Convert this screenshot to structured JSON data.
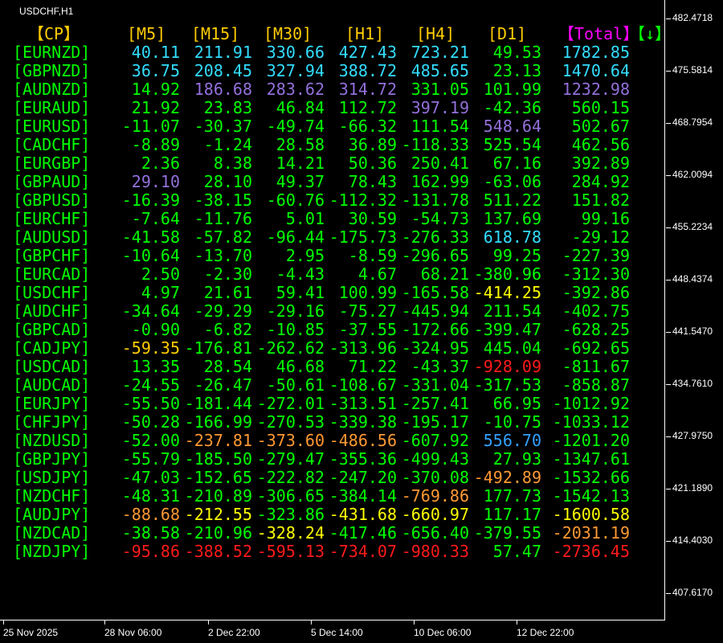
{
  "window": {
    "symbol_title": "USDCHF,H1"
  },
  "colors": {
    "green": "#00ff00",
    "cyan": "#33ddff",
    "purple": "#9370db",
    "yellow": "#ffff00",
    "gold": "#ffcc00",
    "orange": "#ff9933",
    "red": "#ff1a1a",
    "blue": "#33a0ff",
    "magenta": "#ff00ff",
    "white": "#ffffff"
  },
  "table": {
    "headers": [
      {
        "text": "【CP】",
        "color": "gold"
      },
      {
        "text": "[M5]",
        "color": "gold"
      },
      {
        "text": "[M15]",
        "color": "gold"
      },
      {
        "text": "[M30]",
        "color": "gold"
      },
      {
        "text": "[H1]",
        "color": "gold"
      },
      {
        "text": "[H4]",
        "color": "gold"
      },
      {
        "text": "[D1]",
        "color": "gold"
      },
      {
        "text": "【Total】",
        "color": "magenta"
      },
      {
        "text": "【↓】",
        "color": "green"
      }
    ],
    "rows": [
      {
        "pair": "[EURNZD]",
        "vals": [
          "40.11",
          "211.91",
          "330.66",
          "427.43",
          "723.21",
          "49.53",
          "1782.85"
        ],
        "colors": [
          "cyan",
          "cyan",
          "cyan",
          "cyan",
          "cyan",
          "green",
          "cyan"
        ]
      },
      {
        "pair": "[GBPNZD]",
        "vals": [
          "36.75",
          "208.45",
          "327.94",
          "388.72",
          "485.65",
          "23.13",
          "1470.64"
        ],
        "colors": [
          "cyan",
          "cyan",
          "cyan",
          "cyan",
          "cyan",
          "green",
          "cyan"
        ]
      },
      {
        "pair": "[AUDNZD]",
        "vals": [
          "14.92",
          "186.68",
          "283.62",
          "314.72",
          "331.05",
          "101.99",
          "1232.98"
        ],
        "colors": [
          "green",
          "purple",
          "purple",
          "purple",
          "green",
          "green",
          "purple"
        ]
      },
      {
        "pair": "[EURAUD]",
        "vals": [
          "21.92",
          "23.83",
          "46.84",
          "112.72",
          "397.19",
          "-42.36",
          "560.15"
        ],
        "colors": [
          "green",
          "green",
          "green",
          "green",
          "purple",
          "green",
          "green"
        ]
      },
      {
        "pair": "[EURUSD]",
        "vals": [
          "-11.07",
          "-30.37",
          "-49.74",
          "-66.32",
          "111.54",
          "548.64",
          "502.67"
        ],
        "colors": [
          "green",
          "green",
          "green",
          "green",
          "green",
          "purple",
          "green"
        ]
      },
      {
        "pair": "[CADCHF]",
        "vals": [
          "-8.89",
          "-1.24",
          "28.58",
          "36.89",
          "-118.33",
          "525.54",
          "462.56"
        ],
        "colors": [
          "green",
          "green",
          "green",
          "green",
          "green",
          "green",
          "green"
        ]
      },
      {
        "pair": "[EURGBP]",
        "vals": [
          "2.36",
          "8.38",
          "14.21",
          "50.36",
          "250.41",
          "67.16",
          "392.89"
        ],
        "colors": [
          "green",
          "green",
          "green",
          "green",
          "green",
          "green",
          "green"
        ]
      },
      {
        "pair": "[GBPAUD]",
        "vals": [
          "29.10",
          "28.10",
          "49.37",
          "78.43",
          "162.99",
          "-63.06",
          "284.92"
        ],
        "colors": [
          "purple",
          "green",
          "green",
          "green",
          "green",
          "green",
          "green"
        ]
      },
      {
        "pair": "[GBPUSD]",
        "vals": [
          "-16.39",
          "-38.15",
          "-60.76",
          "-112.32",
          "-131.78",
          "511.22",
          "151.82"
        ],
        "colors": [
          "green",
          "green",
          "green",
          "green",
          "green",
          "green",
          "green"
        ]
      },
      {
        "pair": "[EURCHF]",
        "vals": [
          "-7.64",
          "-11.76",
          "5.01",
          "30.59",
          "-54.73",
          "137.69",
          "99.16"
        ],
        "colors": [
          "green",
          "green",
          "green",
          "green",
          "green",
          "green",
          "green"
        ]
      },
      {
        "pair": "[AUDUSD]",
        "vals": [
          "-41.58",
          "-57.82",
          "-96.44",
          "-175.73",
          "-276.33",
          "618.78",
          "-29.12"
        ],
        "colors": [
          "green",
          "green",
          "green",
          "green",
          "green",
          "cyan",
          "green"
        ]
      },
      {
        "pair": "[GBPCHF]",
        "vals": [
          "-10.64",
          "-13.70",
          "2.95",
          "-8.59",
          "-296.65",
          "99.25",
          "-227.39"
        ],
        "colors": [
          "green",
          "green",
          "green",
          "green",
          "green",
          "green",
          "green"
        ]
      },
      {
        "pair": "[EURCAD]",
        "vals": [
          "2.50",
          "-2.30",
          "-4.43",
          "4.67",
          "68.21",
          "-380.96",
          "-312.30"
        ],
        "colors": [
          "green",
          "green",
          "green",
          "green",
          "green",
          "green",
          "green"
        ]
      },
      {
        "pair": "[USDCHF]",
        "vals": [
          "4.97",
          "21.61",
          "59.41",
          "100.99",
          "-165.58",
          "-414.25",
          "-392.86"
        ],
        "colors": [
          "green",
          "green",
          "green",
          "green",
          "green",
          "yellow",
          "green"
        ]
      },
      {
        "pair": "[AUDCHF]",
        "vals": [
          "-34.64",
          "-29.29",
          "-29.16",
          "-75.27",
          "-445.94",
          "211.54",
          "-402.75"
        ],
        "colors": [
          "green",
          "green",
          "green",
          "green",
          "green",
          "green",
          "green"
        ]
      },
      {
        "pair": "[GBPCAD]",
        "vals": [
          "-0.90",
          "-6.82",
          "-10.85",
          "-37.55",
          "-172.66",
          "-399.47",
          "-628.25"
        ],
        "colors": [
          "green",
          "green",
          "green",
          "green",
          "green",
          "green",
          "green"
        ]
      },
      {
        "pair": "[CADJPY]",
        "vals": [
          "-59.35",
          "-176.81",
          "-262.62",
          "-313.96",
          "-324.95",
          "445.04",
          "-692.65"
        ],
        "colors": [
          "gold",
          "green",
          "green",
          "green",
          "green",
          "green",
          "green"
        ]
      },
      {
        "pair": "[USDCAD]",
        "vals": [
          "13.35",
          "28.54",
          "46.68",
          "71.22",
          "-43.37",
          "-928.09",
          "-811.67"
        ],
        "colors": [
          "green",
          "green",
          "green",
          "green",
          "green",
          "red",
          "green"
        ]
      },
      {
        "pair": "[AUDCAD]",
        "vals": [
          "-24.55",
          "-26.47",
          "-50.61",
          "-108.67",
          "-331.04",
          "-317.53",
          "-858.87"
        ],
        "colors": [
          "green",
          "green",
          "green",
          "green",
          "green",
          "green",
          "green"
        ]
      },
      {
        "pair": "[EURJPY]",
        "vals": [
          "-55.50",
          "-181.44",
          "-272.01",
          "-313.51",
          "-257.41",
          "66.95",
          "-1012.92"
        ],
        "colors": [
          "green",
          "green",
          "green",
          "green",
          "green",
          "green",
          "green"
        ]
      },
      {
        "pair": "[CHFJPY]",
        "vals": [
          "-50.28",
          "-166.99",
          "-270.53",
          "-339.38",
          "-195.17",
          "-10.75",
          "-1033.12"
        ],
        "colors": [
          "green",
          "green",
          "green",
          "green",
          "green",
          "green",
          "green"
        ]
      },
      {
        "pair": "[NZDUSD]",
        "vals": [
          "-52.00",
          "-237.81",
          "-373.60",
          "-486.56",
          "-607.92",
          "556.70",
          "-1201.20"
        ],
        "colors": [
          "green",
          "orange",
          "orange",
          "orange",
          "green",
          "blue",
          "green"
        ]
      },
      {
        "pair": "[GBPJPY]",
        "vals": [
          "-55.79",
          "-185.50",
          "-279.47",
          "-355.36",
          "-499.43",
          "27.93",
          "-1347.61"
        ],
        "colors": [
          "green",
          "green",
          "green",
          "green",
          "green",
          "green",
          "green"
        ]
      },
      {
        "pair": "[USDJPY]",
        "vals": [
          "-47.03",
          "-152.65",
          "-222.82",
          "-247.20",
          "-370.08",
          "-492.89",
          "-1532.66"
        ],
        "colors": [
          "green",
          "green",
          "green",
          "green",
          "green",
          "orange",
          "green"
        ]
      },
      {
        "pair": "[NZDCHF]",
        "vals": [
          "-48.31",
          "-210.89",
          "-306.65",
          "-384.14",
          "-769.86",
          "177.73",
          "-1542.13"
        ],
        "colors": [
          "green",
          "green",
          "green",
          "green",
          "orange",
          "green",
          "green"
        ]
      },
      {
        "pair": "[AUDJPY]",
        "vals": [
          "-88.68",
          "-212.55",
          "-323.86",
          "-431.68",
          "-660.97",
          "117.17",
          "-1600.58"
        ],
        "colors": [
          "orange",
          "yellow",
          "green",
          "yellow",
          "yellow",
          "green",
          "yellow"
        ]
      },
      {
        "pair": "[NZDCAD]",
        "vals": [
          "-38.58",
          "-210.96",
          "-328.24",
          "-417.46",
          "-656.40",
          "-379.55",
          "-2031.19"
        ],
        "colors": [
          "green",
          "green",
          "yellow",
          "green",
          "green",
          "green",
          "orange"
        ]
      },
      {
        "pair": "[NZDJPY]",
        "vals": [
          "-95.86",
          "-388.52",
          "-595.13",
          "-734.07",
          "-980.33",
          "57.47",
          "-2736.45"
        ],
        "colors": [
          "red",
          "red",
          "red",
          "red",
          "red",
          "green",
          "red"
        ]
      }
    ]
  },
  "price_axis": [
    "482.4718",
    "475.5814",
    "468.7954",
    "462.0094",
    "455.2234",
    "448.4374",
    "441.5470",
    "434.7610",
    "427.9750",
    "421.1890",
    "414.4030",
    "407.6170"
  ],
  "time_axis": [
    "25 Nov 2025",
    "28 Nov 06:00",
    "2 Dec 22:00",
    "5 Dec 14:00",
    "10 Dec 06:00",
    "12 Dec 22:00"
  ]
}
